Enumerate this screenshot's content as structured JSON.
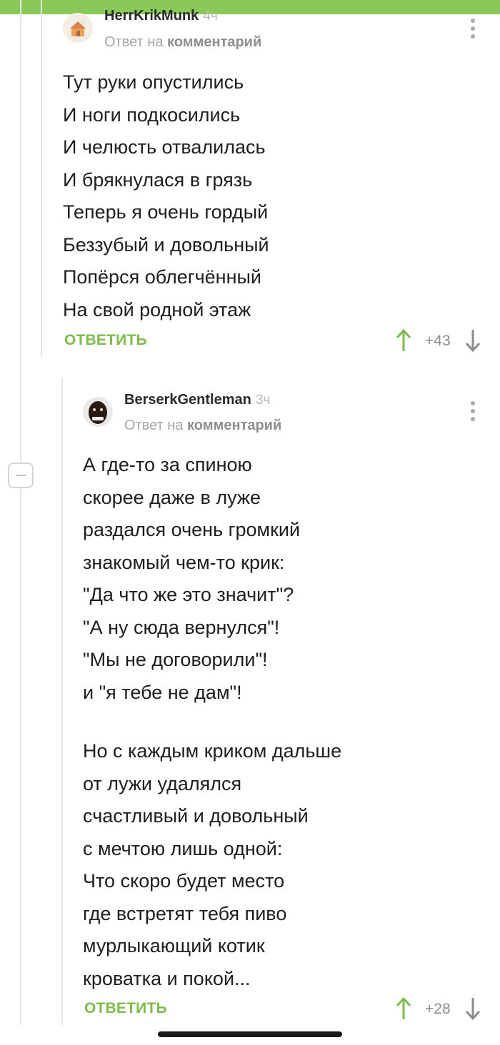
{
  "colors": {
    "accent": "#8ac858",
    "reply": "#7dbb4c",
    "text": "#1e1e1e",
    "muted": "#a6a6a6"
  },
  "comments": [
    {
      "author": "HerrKrikMunk",
      "time": "4ч",
      "reply_prefix": "Ответ на",
      "reply_target": "комментарий",
      "avatar_icon": "house-avatar-icon",
      "lines": [
        "Тут руки опустились",
        "И ноги подкосились",
        "И челюсть отвалилась",
        "И брякнулася в грязь",
        "Теперь я очень гордый",
        "Беззубый и довольный",
        "Попёрся облегчённый",
        "На свой родной этаж"
      ],
      "reply_label": "ОТВЕТИТЬ",
      "score": "+43"
    },
    {
      "author": "BerserkGentleman",
      "time": "3ч",
      "reply_prefix": "Ответ на",
      "reply_target": "комментарий",
      "avatar_icon": "smiling-man-avatar-icon",
      "lines": [
        "А где-то за спиною",
        "скорее даже в луже",
        "раздался очень громкий",
        "знакомый чем-то крик:",
        "\"Да что же это значит\"?",
        "\"А ну сюда вернулся\"!",
        "\"Мы не договорили\"!",
        "и \"я тебе не дам\"!",
        "",
        "Но с каждым криком дальше",
        "от лужи удалялся",
        "счастливый и довольный",
        "с мечтою лишь одной:",
        "Что скоро будет место",
        "где встретят тебя пиво",
        "мурлыкающий котик",
        "кроватка и покой..."
      ],
      "reply_label": "ОТВЕТИТЬ",
      "score": "+28"
    }
  ]
}
